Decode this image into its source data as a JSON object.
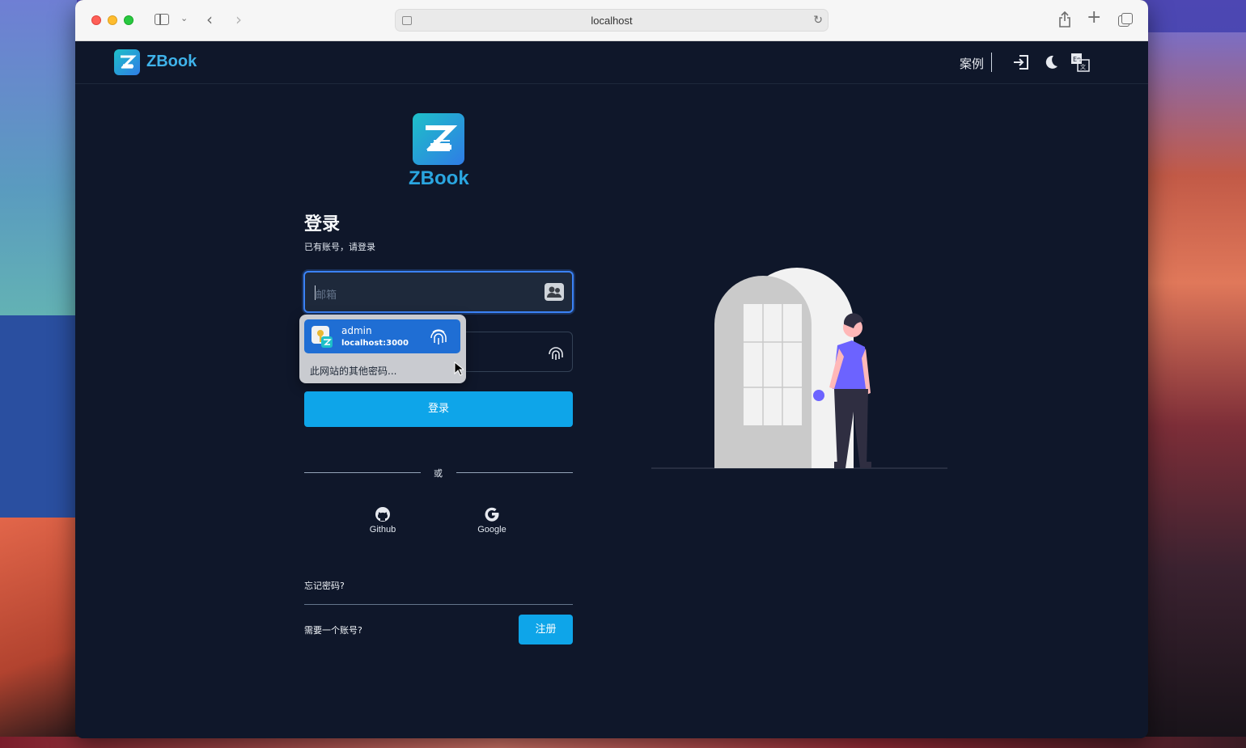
{
  "browser": {
    "address": "localhost"
  },
  "nav": {
    "brand": "ZBook",
    "cases": "案例"
  },
  "hero": {
    "name": "ZBook"
  },
  "login": {
    "title": "登录",
    "subtitle": "已有账号，请登录",
    "email_placeholder": "邮箱",
    "submit_label": "登录",
    "or_text": "或",
    "forgot": "忘记密码?",
    "need_account": "需要一个账号?",
    "register_label": "注册"
  },
  "autofill": {
    "username": "admin",
    "host": "localhost:3000",
    "other": "此网站的其他密码..."
  },
  "social": [
    {
      "label": "Github",
      "icon": "github-icon"
    },
    {
      "label": "Google",
      "icon": "google-icon"
    }
  ],
  "colors": {
    "page_bg": "#0f172a",
    "primary": "#0ea5e9",
    "brand": "#2aa6e0",
    "autofill_selected": "#1f6ed4"
  }
}
